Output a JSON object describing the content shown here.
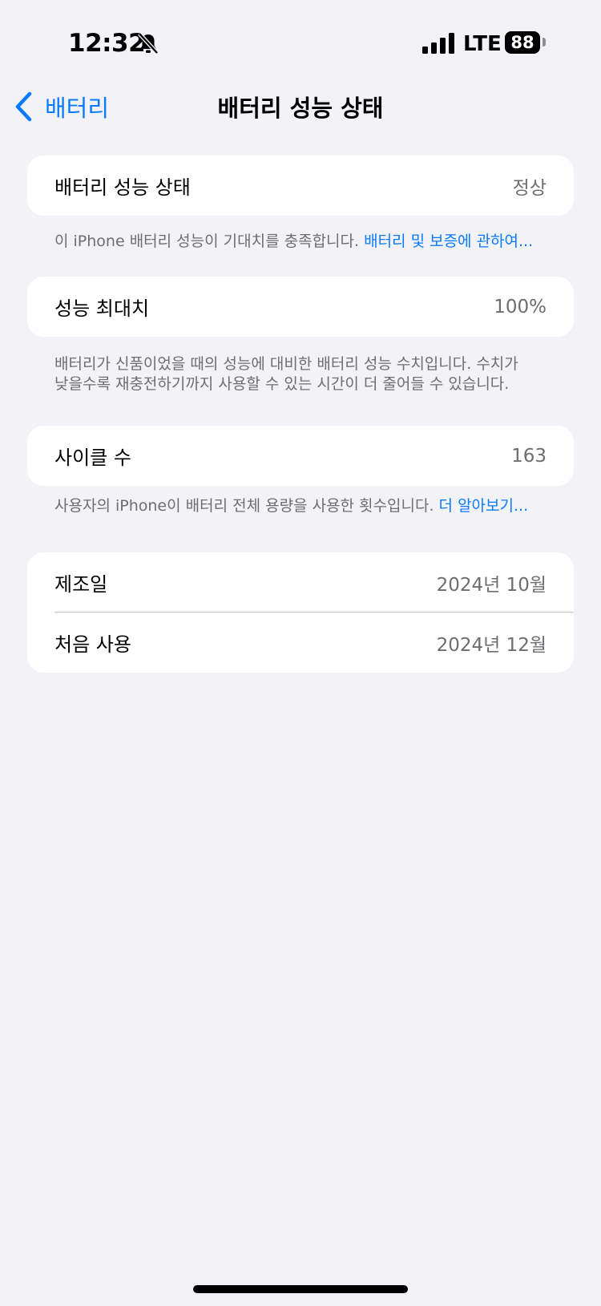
{
  "status_bar": {
    "time": "12:32",
    "network": "LTE",
    "battery_level": "88",
    "icons": [
      "bell-slash-icon",
      "cellular-signal-icon",
      "battery-icon"
    ]
  },
  "nav": {
    "back_label": "배터리",
    "title": "배터리 성능 상태"
  },
  "sections": {
    "health": {
      "label": "배터리 성능 상태",
      "value": "정상",
      "footnote": "이 iPhone 배터리 성능이 기대치를 충족합니다. ",
      "footnote_link": "배터리 및 보증에 관하여..."
    },
    "max_capacity": {
      "label": "성능 최대치",
      "value": "100%",
      "footnote_line1": "배터리가 신품이었을 때의 성능에 대비한 배터리 성능 수치입니다. 수치가",
      "footnote_line2": "낮을수록 재충전하기까지 사용할 수 있는 시간이 더 줄어들 수 있습니다."
    },
    "cycle_count": {
      "label": "사이클 수",
      "value": "163",
      "footnote": "사용자의 iPhone이 배터리 전체 용량을 사용한 횟수입니다. ",
      "footnote_link": "더 알아보기..."
    },
    "dates": {
      "manufacture_label": "제조일",
      "manufacture_value": "2024년 10월",
      "first_use_label": "처음 사용",
      "first_use_value": "2024년 12월"
    }
  },
  "colors": {
    "accent": "#0a7aff",
    "background": "#f2f2f7",
    "secondary_text": "#6d6d72"
  }
}
